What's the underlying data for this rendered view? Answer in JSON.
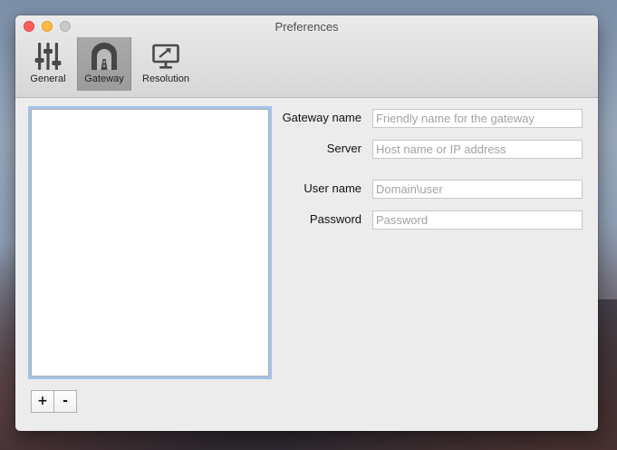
{
  "window": {
    "title": "Preferences"
  },
  "toolbar": {
    "tabs": [
      {
        "label": "General",
        "icon": "sliders-icon",
        "selected": false
      },
      {
        "label": "Gateway",
        "icon": "tunnel-icon",
        "selected": true
      },
      {
        "label": "Resolution",
        "icon": "monitor-icon",
        "selected": false
      }
    ]
  },
  "gateway_list": {
    "items": [],
    "add_label": "+",
    "remove_label": "-"
  },
  "form": {
    "gateway_name": {
      "label": "Gateway name",
      "value": "",
      "placeholder": "Friendly name for the gateway"
    },
    "server": {
      "label": "Server",
      "value": "",
      "placeholder": "Host name or IP address"
    },
    "user_name": {
      "label": "User name",
      "value": "",
      "placeholder": "Domain\\user"
    },
    "password": {
      "label": "Password",
      "value": "",
      "placeholder": "Password"
    }
  },
  "colors": {
    "selected_tab": "#9b9b9b",
    "focus_ring": "#6ca0e6",
    "close": "#fc605c",
    "minimize": "#fdbc40",
    "zoom_disabled": "#c9c9c9"
  }
}
